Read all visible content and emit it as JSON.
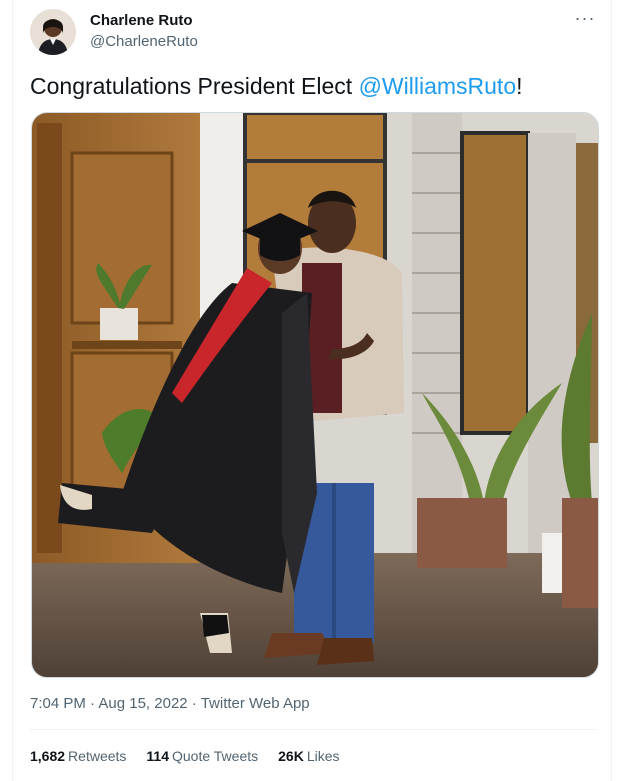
{
  "author": {
    "name": "Charlene Ruto",
    "handle": "@CharleneRuto"
  },
  "tweet": {
    "text_before": "Congratulations President Elect ",
    "mention": "@WilliamsRuto",
    "text_after": "!"
  },
  "meta": {
    "time": "7:04 PM",
    "separator1": " · ",
    "date": "Aug 15, 2022",
    "separator2": " · ",
    "source": "Twitter Web App"
  },
  "stats": {
    "retweets_count": "1,682",
    "retweets_label": "Retweets",
    "quotes_count": "114",
    "quotes_label": "Quote Tweets",
    "likes_count": "26K",
    "likes_label": "Likes"
  },
  "icons": {
    "more": "more-options-icon"
  },
  "colors": {
    "link": "#1d9bf0",
    "secondary_text": "#536471",
    "primary_text": "#0f1419"
  }
}
